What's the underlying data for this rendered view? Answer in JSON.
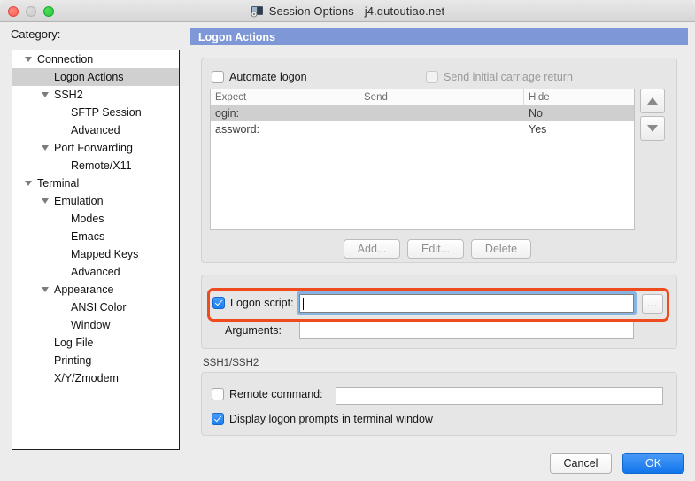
{
  "window": {
    "title": "Session Options - j4.qutoutiao.net",
    "app_icon": "session-options-icon",
    "traffic_lights": {
      "close": "close-button",
      "minimize": "minimize-button",
      "maximize": "maximize-button"
    }
  },
  "sidebar": {
    "label": "Category:",
    "items": [
      {
        "label": "Connection",
        "indent": 0,
        "expanded": true,
        "selected": false
      },
      {
        "label": "Logon Actions",
        "indent": 1,
        "expanded": null,
        "selected": true
      },
      {
        "label": "SSH2",
        "indent": 1,
        "expanded": true,
        "selected": false
      },
      {
        "label": "SFTP Session",
        "indent": 2,
        "expanded": null,
        "selected": false
      },
      {
        "label": "Advanced",
        "indent": 2,
        "expanded": null,
        "selected": false
      },
      {
        "label": "Port Forwarding",
        "indent": 1,
        "expanded": true,
        "selected": false
      },
      {
        "label": "Remote/X11",
        "indent": 2,
        "expanded": null,
        "selected": false
      },
      {
        "label": "Terminal",
        "indent": 0,
        "expanded": true,
        "selected": false
      },
      {
        "label": "Emulation",
        "indent": 1,
        "expanded": true,
        "selected": false
      },
      {
        "label": "Modes",
        "indent": 2,
        "expanded": null,
        "selected": false
      },
      {
        "label": "Emacs",
        "indent": 2,
        "expanded": null,
        "selected": false
      },
      {
        "label": "Mapped Keys",
        "indent": 2,
        "expanded": null,
        "selected": false
      },
      {
        "label": "Advanced",
        "indent": 2,
        "expanded": null,
        "selected": false
      },
      {
        "label": "Appearance",
        "indent": 1,
        "expanded": true,
        "selected": false
      },
      {
        "label": "ANSI Color",
        "indent": 2,
        "expanded": null,
        "selected": false
      },
      {
        "label": "Window",
        "indent": 2,
        "expanded": null,
        "selected": false
      },
      {
        "label": "Log File",
        "indent": 1,
        "expanded": null,
        "selected": false
      },
      {
        "label": "Printing",
        "indent": 1,
        "expanded": null,
        "selected": false
      },
      {
        "label": "X/Y/Zmodem",
        "indent": 1,
        "expanded": null,
        "selected": false
      }
    ]
  },
  "pane": {
    "header": "Logon Actions",
    "automate": {
      "checkbox_label": "Automate logon",
      "checked": false,
      "carriage_label": "Send initial carriage return",
      "carriage_checked": false,
      "carriage_enabled": false,
      "table": {
        "columns": [
          "Expect",
          "Send",
          "Hide"
        ],
        "rows": [
          {
            "expect": "ogin:",
            "send": "",
            "hide": "No",
            "selected": true
          },
          {
            "expect": "assword:",
            "send": "",
            "hide": "Yes",
            "selected": false
          }
        ]
      },
      "spinner_up": "move-up-arrow",
      "spinner_down": "move-down-arrow",
      "buttons": {
        "add": "Add...",
        "edit": "Edit...",
        "delete": "Delete"
      }
    },
    "script": {
      "checkbox_label": "Logon script:",
      "checked": true,
      "value": "",
      "browse_label": "...",
      "arguments_label": "Arguments:",
      "arguments_value": ""
    },
    "ssh": {
      "legend": "SSH1/SSH2",
      "remote_label": "Remote command:",
      "remote_checked": false,
      "remote_value": "",
      "display_label": "Display logon prompts in terminal window",
      "display_checked": true
    }
  },
  "footer": {
    "cancel": "Cancel",
    "ok": "OK"
  },
  "colors": {
    "header_blue": "#7e97d6",
    "highlight_orange": "#f04a1f",
    "focus_blue": "#76aae1",
    "ok_blue": "#1175ec",
    "selection_gray": "#cfcfcf"
  }
}
